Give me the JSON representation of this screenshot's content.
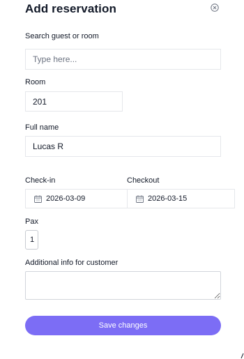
{
  "dialog": {
    "title": "Add reservation",
    "save_label": "Save changes"
  },
  "search": {
    "label": "Search guest or room",
    "placeholder": "Type here...",
    "value": ""
  },
  "room": {
    "label": "Room",
    "value": "201"
  },
  "full_name": {
    "label": "Full name",
    "value": "Lucas R"
  },
  "check_in": {
    "label": "Check-in",
    "value": "2026-03-09",
    "icon": "calendar-icon"
  },
  "checkout": {
    "label": "Checkout",
    "value": "2026-03-15",
    "icon": "calendar-icon"
  },
  "pax": {
    "label": "Pax",
    "value": "1"
  },
  "additional_info": {
    "label": "Additional info for customer",
    "value": ""
  },
  "colors": {
    "accent": "#7c6df5",
    "border": "#e5e7eb",
    "text": "#111827",
    "placeholder": "#6b7280"
  }
}
